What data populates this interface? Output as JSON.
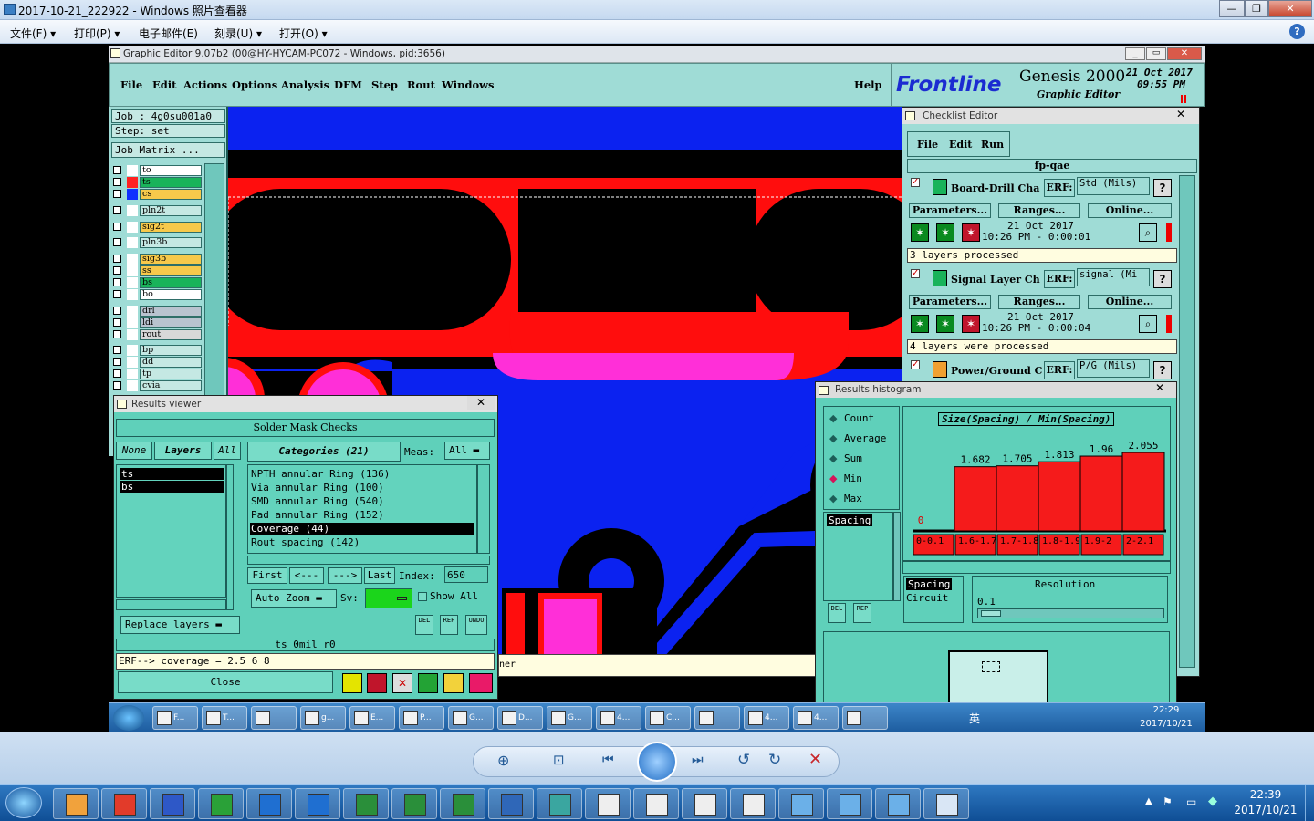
{
  "photo_viewer": {
    "title": "2017-10-21_222922 - Windows 照片查看器",
    "menu": [
      {
        "label": "文件(F)",
        "has_arrow": true
      },
      {
        "label": "打印(P)",
        "has_arrow": true
      },
      {
        "label": "电子邮件(E)",
        "has_arrow": false
      },
      {
        "label": "刻录(U)",
        "has_arrow": true
      },
      {
        "label": "打开(O)",
        "has_arrow": true
      }
    ],
    "help_icon": "?",
    "window_buttons": [
      "—",
      "❐",
      "✕"
    ]
  },
  "ge": {
    "title": "Graphic Editor 9.07b2 (00@HY-HYCAM-PC072 - Windows, pid:3656)",
    "menu": [
      "File",
      "Edit",
      "Actions",
      "Options",
      "Analysis",
      "DFM",
      "Step",
      "Rout",
      "Windows"
    ],
    "help": "Help",
    "brand": {
      "logo": "Frontline",
      "product": "Genesis 2000",
      "sub": "Graphic Editor",
      "date": "21 Oct 2017",
      "time": "09:55 PM"
    },
    "job": "Job : 4g0su001a0",
    "step": "Step: set",
    "job_matrix": "Job Matrix ...",
    "layers": [
      {
        "name": "to",
        "color": "#ffffff",
        "sq": "#ffffff"
      },
      {
        "name": "ts",
        "color": "#19b35a",
        "sq": "#ff2222"
      },
      {
        "name": "cs",
        "color": "#f7c94b",
        "sq": "#1030ff"
      },
      {
        "name": "pln2t",
        "color": "#c5e8e3",
        "sq": "#ffffff"
      },
      {
        "name": "sig2t",
        "color": "#f7c94b",
        "sq": "#ffffff"
      },
      {
        "name": "pln3b",
        "color": "#c5e8e3",
        "sq": "#ffffff"
      },
      {
        "name": "sig3b",
        "color": "#f7c94b",
        "sq": "#ffffff"
      },
      {
        "name": "ss",
        "color": "#f7c94b",
        "sq": "#ffffff"
      },
      {
        "name": "bs",
        "color": "#19b35a",
        "sq": "#ffffff"
      },
      {
        "name": "bo",
        "color": "#ffffff",
        "sq": "#ffffff"
      },
      {
        "name": "drl",
        "color": "#b9c3cf",
        "sq": "#ffffff"
      },
      {
        "name": "ldi",
        "color": "#b9c3cf",
        "sq": "#ffffff"
      },
      {
        "name": "rout",
        "color": "#d8d8d8",
        "sq": "#ffffff"
      },
      {
        "name": "bp",
        "color": "#c5e8e3",
        "sq": "#ffffff"
      },
      {
        "name": "dd",
        "color": "#c5e8e3",
        "sq": "#ffffff"
      },
      {
        "name": "tp",
        "color": "#c5e8e3",
        "sq": "#ffffff"
      },
      {
        "name": "cvia",
        "color": "#c5e8e3",
        "sq": "#ffffff"
      }
    ],
    "status_tail": "ner"
  },
  "results_viewer": {
    "title": "Results viewer",
    "header": "Solder Mask Checks",
    "none_btn": "None",
    "layers_btn": "Layers",
    "all_btn": "All",
    "categories_label": "Categories (21)",
    "meas_label": "Meas:",
    "meas_value": "All",
    "layers_list": [
      "ts",
      "bs"
    ],
    "categories": [
      "NPTH annular Ring (136)",
      "Via annular Ring (100)",
      "SMD annular Ring (540)",
      "Pad annular Ring (152)",
      "Coverage (44)",
      "Rout spacing (142)"
    ],
    "selected_category": 4,
    "nav": {
      "first": "First",
      "prev": "<---",
      "next": "--->",
      "last": "Last",
      "index_label": "Index:",
      "index_value": "650"
    },
    "auto_zoom": "Auto Zoom",
    "sv_label": "Sv:",
    "show_all": "Show All",
    "replace_layers": "Replace layers",
    "status1": "ts  0mil   r0",
    "status2": "ERF--> coverage = 2.5 6 8",
    "close": "Close",
    "small_btns": [
      "DEL",
      "REP",
      "UNDO"
    ]
  },
  "checklist": {
    "title": "Checklist Editor",
    "menu": [
      "File",
      "Edit",
      "Run"
    ],
    "name": "fp-qae",
    "erf_label": "ERF:",
    "actions": [
      {
        "name": "Board-Drill Cha",
        "erf": "Std (Mils)",
        "date": "21 Oct 2017",
        "time": "10:26 PM - 0:00:01",
        "status": "3 layers processed"
      },
      {
        "name": "Signal Layer Ch",
        "erf": "signal (Mi",
        "date": "21 Oct 2017",
        "time": "10:26 PM - 0:00:04",
        "status": "4 layers were processed"
      },
      {
        "name": "Power/Ground C",
        "erf": "P/G (Mils)",
        "date": "",
        "time": "",
        "status": ""
      }
    ],
    "row_buttons": [
      "Parameters...",
      "Ranges...",
      "Online..."
    ],
    "help_btn": "?"
  },
  "histogram": {
    "title": "Results histogram",
    "modes": [
      {
        "label": "Count",
        "selected": false
      },
      {
        "label": "Average",
        "selected": false
      },
      {
        "label": "Sum",
        "selected": false
      },
      {
        "label": "Min",
        "selected": true
      },
      {
        "label": "Max",
        "selected": false
      }
    ],
    "measure_list": [
      "Spacing"
    ],
    "chart_title": "Size(Spacing) / Min(Spacing)",
    "bins": [
      "0-0.1",
      "1.6-1.7",
      "1.7-1.8",
      "1.8-1.9",
      "1.9-2",
      "2-2.1"
    ],
    "values": [
      0,
      1.682,
      1.705,
      1.813,
      1.96,
      2.055
    ],
    "value_labels": [
      "0",
      "1.682",
      "1.705",
      "1.813",
      "1.96",
      "2.055"
    ],
    "list2": [
      "Spacing",
      "Circuit"
    ],
    "resolution_label": "Resolution",
    "resolution_value": "0.1",
    "small_btns": [
      "DEL",
      "REP"
    ]
  },
  "chart_data": {
    "type": "bar",
    "title": "Size(Spacing) / Min(Spacing)",
    "categories": [
      "0-0.1",
      "1.6-1.7",
      "1.7-1.8",
      "1.8-1.9",
      "1.9-2",
      "2-2.1"
    ],
    "values": [
      0,
      1.682,
      1.705,
      1.813,
      1.96,
      2.055
    ],
    "xlabel": "",
    "ylabel": ""
  },
  "taskbar_inner": {
    "items": [
      "F...",
      "T...",
      "",
      "g...",
      "E...",
      "P...",
      "G...",
      "D...",
      "G...",
      "4...",
      "C...",
      "",
      "4...",
      "4...",
      ""
    ],
    "ime": "英",
    "time": "22:29",
    "date": "2017/10/21"
  },
  "taskbar": {
    "time": "22:39",
    "date": "2017/10/21"
  }
}
